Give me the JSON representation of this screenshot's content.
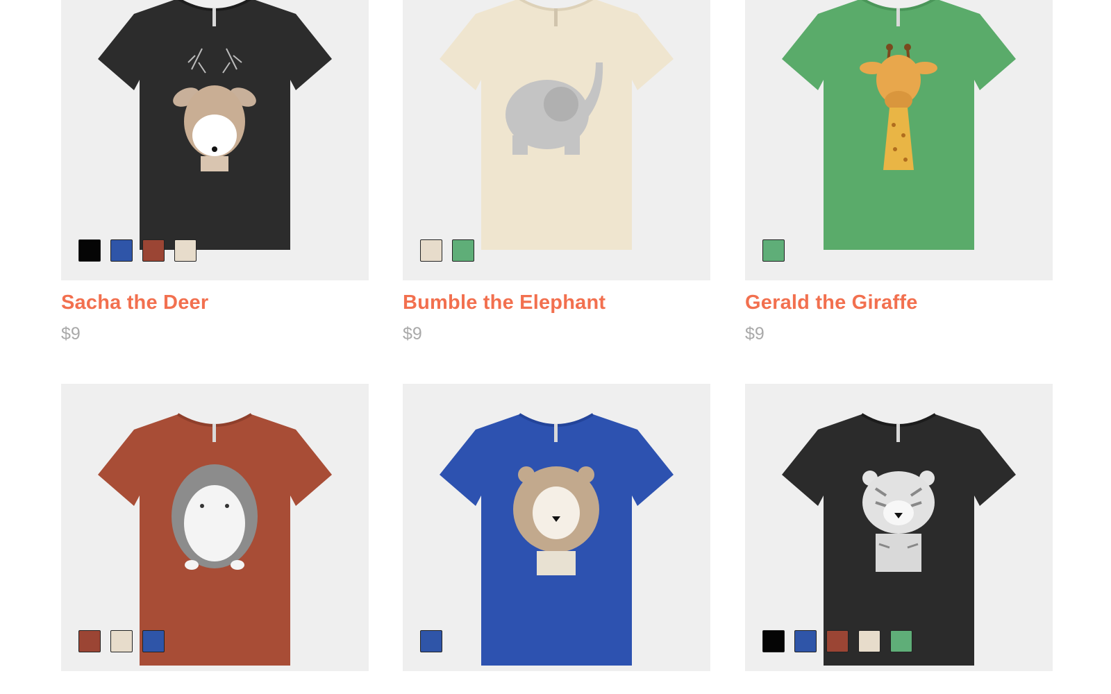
{
  "products": [
    {
      "name": "Sacha the Deer",
      "price": "$9",
      "shirt_color": "#2c2c2c",
      "animal_icon": "deer-icon",
      "swatches": [
        "#050505",
        "#2f55a8",
        "#9b4534",
        "#e7dccb"
      ]
    },
    {
      "name": "Bumble the Elephant",
      "price": "$9",
      "shirt_color": "#efe5cf",
      "animal_icon": "elephant-icon",
      "swatches": [
        "#e7dccb",
        "#5fae78"
      ]
    },
    {
      "name": "Gerald the Giraffe",
      "price": "$9",
      "shirt_color": "#5aab6a",
      "animal_icon": "giraffe-icon",
      "swatches": [
        "#5fae78"
      ]
    },
    {
      "name": "",
      "price": "",
      "shirt_color": "#a84d36",
      "animal_icon": "hedgehog-icon",
      "swatches": [
        "#9b4534",
        "#e7dccb",
        "#2f55a8"
      ]
    },
    {
      "name": "",
      "price": "",
      "shirt_color": "#2d52b0",
      "animal_icon": "lion-icon",
      "swatches": [
        "#2f55a8"
      ]
    },
    {
      "name": "",
      "price": "",
      "shirt_color": "#2b2b2b",
      "animal_icon": "tiger-icon",
      "swatches": [
        "#050505",
        "#2f55a8",
        "#9b4534",
        "#e7dccb",
        "#5fae78"
      ]
    }
  ],
  "colors": {
    "title": "#f2704f",
    "price": "#a9a9a9",
    "card_bg": "#efefef"
  }
}
